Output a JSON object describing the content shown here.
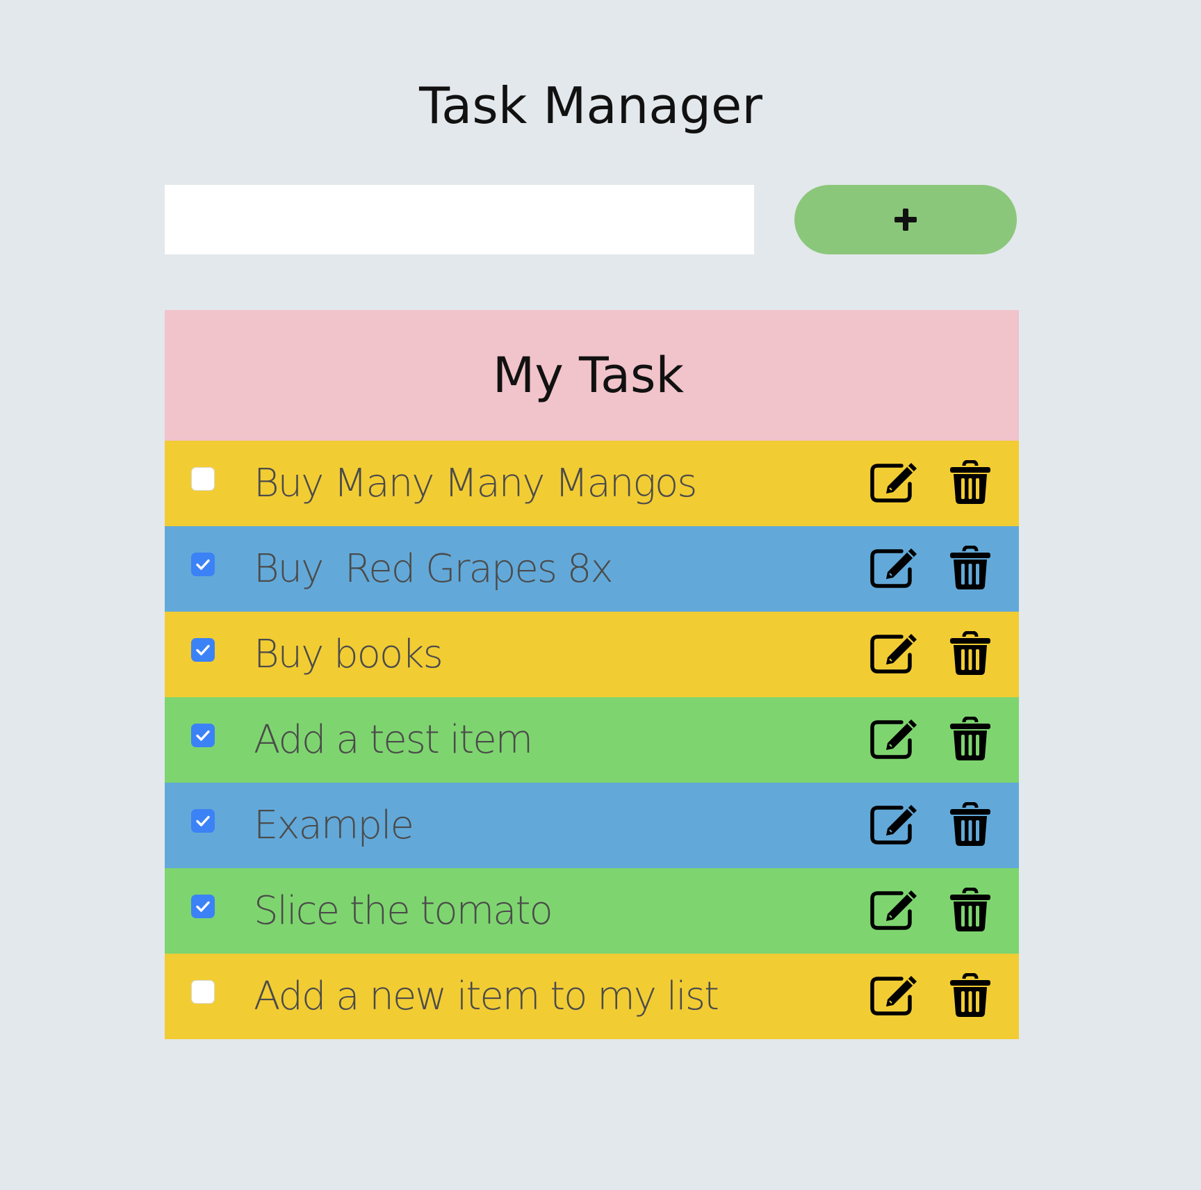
{
  "app": {
    "title": "Task Manager"
  },
  "new_task": {
    "input_value": "",
    "placeholder": "",
    "add_label": "+",
    "add_icon": "plus-icon"
  },
  "list": {
    "title": "My Task",
    "tasks": [
      {
        "text": "Buy Many Many Mangos",
        "checked": false,
        "color": "#f2cc33"
      },
      {
        "text": "Buy  Red Grapes 8x",
        "checked": true,
        "color": "#62a9d9"
      },
      {
        "text": "Buy books",
        "checked": true,
        "color": "#f2cc33"
      },
      {
        "text": "Add a test item",
        "checked": true,
        "color": "#7ed56f"
      },
      {
        "text": "Example",
        "checked": true,
        "color": "#62a9d9"
      },
      {
        "text": "Slice the tomato",
        "checked": true,
        "color": "#7ed56f"
      },
      {
        "text": "Add a new item to my list",
        "checked": false,
        "color": "#f2cc33"
      }
    ],
    "row_icons": [
      "edit-icon",
      "trash-icon"
    ]
  },
  "colors": {
    "background": "#e3e8ec",
    "add_button": "#8bc77a",
    "header": "#f1c3ca",
    "checkbox_checked": "#3b82f6"
  }
}
